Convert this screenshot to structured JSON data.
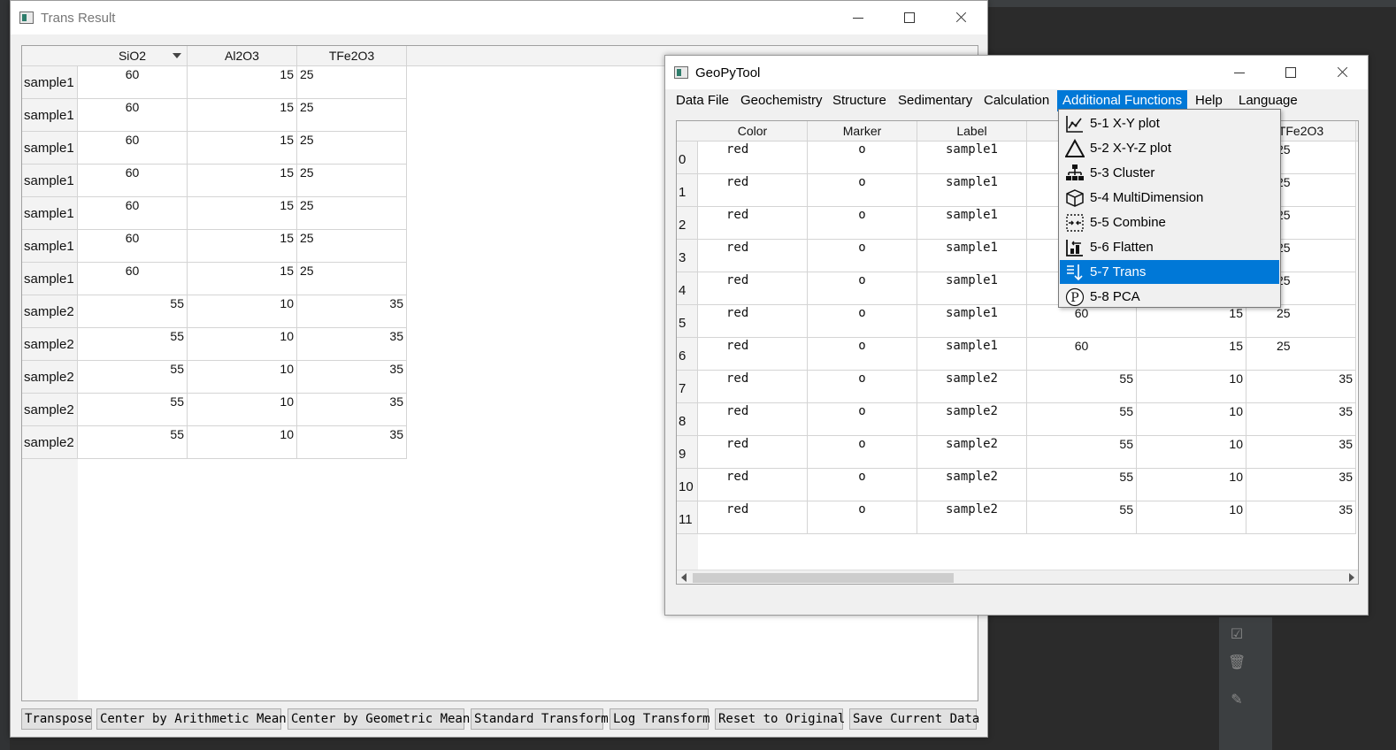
{
  "trans_window": {
    "title": "Trans Result",
    "headers": [
      "SiO2",
      "Al2O3",
      "TFe2O3"
    ],
    "rows": [
      {
        "label": "sample1",
        "values": [
          "60",
          "15",
          "25"
        ]
      },
      {
        "label": "sample1",
        "values": [
          "60",
          "15",
          "25"
        ]
      },
      {
        "label": "sample1",
        "values": [
          "60",
          "15",
          "25"
        ]
      },
      {
        "label": "sample1",
        "values": [
          "60",
          "15",
          "25"
        ]
      },
      {
        "label": "sample1",
        "values": [
          "60",
          "15",
          "25"
        ]
      },
      {
        "label": "sample1",
        "values": [
          "60",
          "15",
          "25"
        ]
      },
      {
        "label": "sample1",
        "values": [
          "60",
          "15",
          "25"
        ]
      },
      {
        "label": "sample2",
        "values": [
          "55",
          "10",
          "35"
        ]
      },
      {
        "label": "sample2",
        "values": [
          "55",
          "10",
          "35"
        ]
      },
      {
        "label": "sample2",
        "values": [
          "55",
          "10",
          "35"
        ]
      },
      {
        "label": "sample2",
        "values": [
          "55",
          "10",
          "35"
        ]
      },
      {
        "label": "sample2",
        "values": [
          "55",
          "10",
          "35"
        ]
      }
    ],
    "buttons": [
      "Transpose",
      "Center by Arithmetic Mean",
      "Center by Geometric Mean",
      "Standard Transform",
      "Log Transform",
      "Reset to Original",
      "Save Current Data"
    ]
  },
  "geo_window": {
    "title": "GeoPyTool",
    "menu": [
      "Data File",
      "Geochemistry",
      "Structure",
      "Sedimentary",
      "Calculation",
      "Additional Functions",
      "Help",
      "Language"
    ],
    "active_menu": "Additional Functions",
    "headers": [
      "Color",
      "Marker",
      "Label",
      "",
      "",
      "TFe2O3"
    ],
    "rows": [
      {
        "index": "0",
        "color": "red",
        "marker": "o",
        "label": "sample1",
        "v1": "",
        "v2": "",
        "v3": "25"
      },
      {
        "index": "1",
        "color": "red",
        "marker": "o",
        "label": "sample1",
        "v1": "",
        "v2": "",
        "v3": "25"
      },
      {
        "index": "2",
        "color": "red",
        "marker": "o",
        "label": "sample1",
        "v1": "",
        "v2": "",
        "v3": "25"
      },
      {
        "index": "3",
        "color": "red",
        "marker": "o",
        "label": "sample1",
        "v1": "",
        "v2": "",
        "v3": "25"
      },
      {
        "index": "4",
        "color": "red",
        "marker": "o",
        "label": "sample1",
        "v1": "",
        "v2": "",
        "v3": "25"
      },
      {
        "index": "5",
        "color": "red",
        "marker": "o",
        "label": "sample1",
        "v1": "60",
        "v2": "15",
        "v3": "25"
      },
      {
        "index": "6",
        "color": "red",
        "marker": "o",
        "label": "sample1",
        "v1": "60",
        "v2": "15",
        "v3": "25"
      },
      {
        "index": "7",
        "color": "red",
        "marker": "o",
        "label": "sample2",
        "v1": "55",
        "v2": "10",
        "v3": "35"
      },
      {
        "index": "8",
        "color": "red",
        "marker": "o",
        "label": "sample2",
        "v1": "55",
        "v2": "10",
        "v3": "35"
      },
      {
        "index": "9",
        "color": "red",
        "marker": "o",
        "label": "sample2",
        "v1": "55",
        "v2": "10",
        "v3": "35"
      },
      {
        "index": "10",
        "color": "red",
        "marker": "o",
        "label": "sample2",
        "v1": "55",
        "v2": "10",
        "v3": "35"
      },
      {
        "index": "11",
        "color": "red",
        "marker": "o",
        "label": "sample2",
        "v1": "55",
        "v2": "10",
        "v3": "35"
      }
    ],
    "dropdown": [
      {
        "label": "5-1 X-Y plot",
        "icon": "xy-plot-icon"
      },
      {
        "label": "5-2 X-Y-Z plot",
        "icon": "triangle-icon"
      },
      {
        "label": "5-3 Cluster",
        "icon": "cluster-icon"
      },
      {
        "label": "5-4 MultiDimension",
        "icon": "cube-icon"
      },
      {
        "label": "5-5 Combine",
        "icon": "combine-icon"
      },
      {
        "label": "5-6 Flatten",
        "icon": "flatten-icon"
      },
      {
        "label": "5-7 Trans",
        "icon": "trans-icon"
      },
      {
        "label": "5-8 PCA",
        "icon": "pca-icon"
      }
    ],
    "selected_dropdown": "5-7 Trans"
  },
  "colors": {
    "accent": "#0078d7"
  }
}
